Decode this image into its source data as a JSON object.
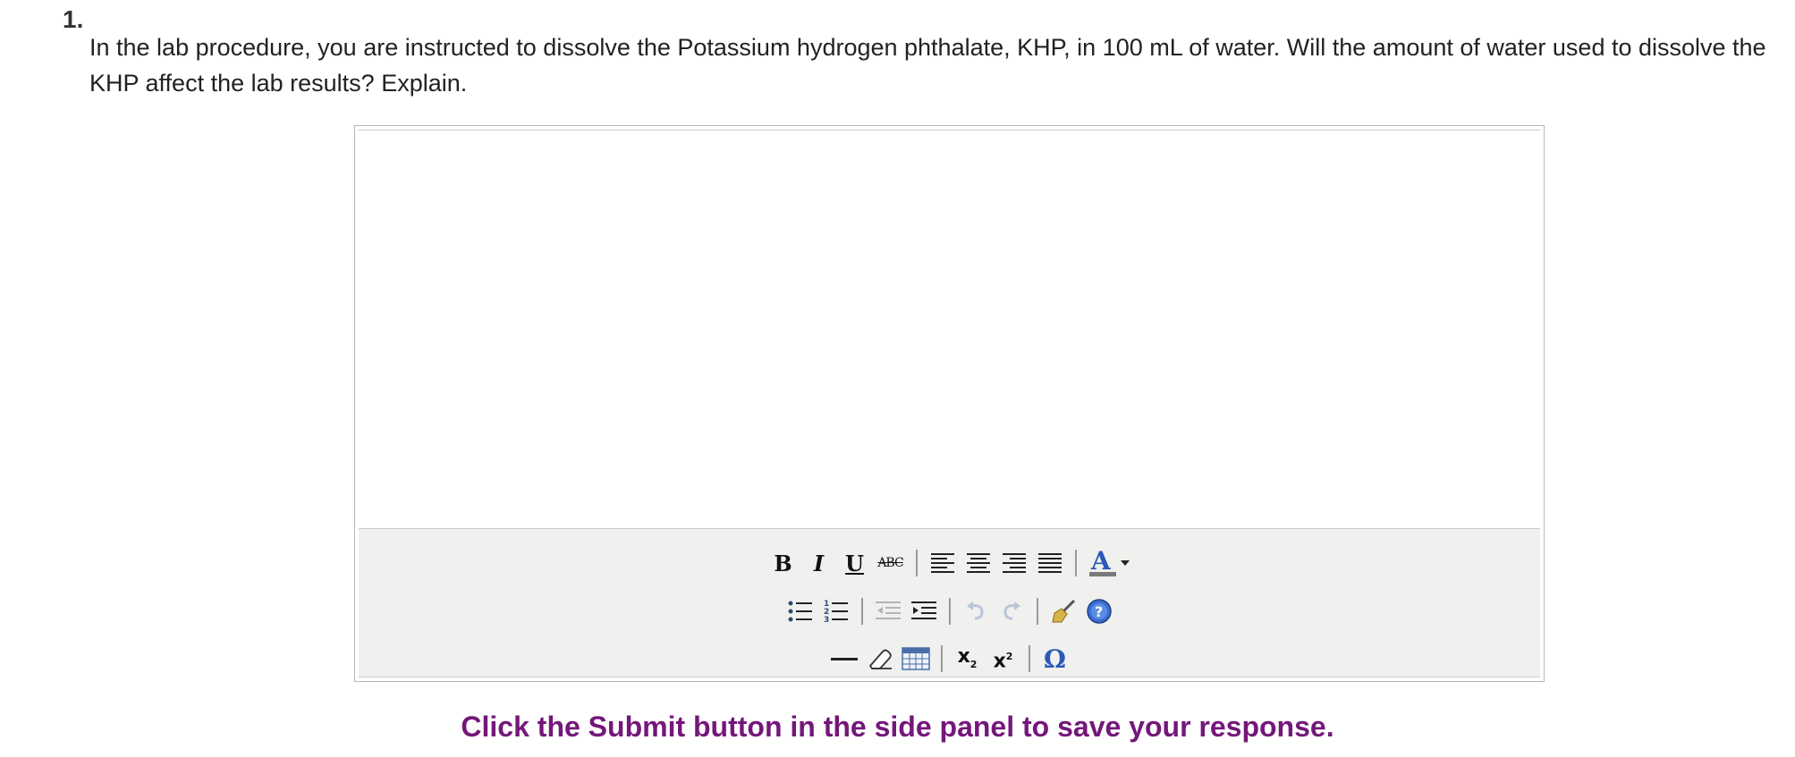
{
  "question": {
    "number": "1.",
    "text": "In the lab procedure, you are instructed to dissolve the Potassium hydrogen phthalate, KHP, in 100 mL of water. Will the amount of water used to dissolve the KHP affect the lab results? Explain."
  },
  "editor": {
    "value": "",
    "toolbar": {
      "bold_label": "B",
      "italic_label": "I",
      "underline_label": "U",
      "strikethrough_label": "ABC",
      "subscript_label": "x",
      "subscript_mark": "2",
      "superscript_label": "x",
      "superscript_mark": "2",
      "special_char_label": "Ω",
      "icons": [
        "bold-icon",
        "italic-icon",
        "underline-icon",
        "strikethrough-icon",
        "align-left-icon",
        "align-center-icon",
        "align-right-icon",
        "align-justify-icon",
        "font-color-icon",
        "dropdown-arrow-icon",
        "bullet-list-icon",
        "numbered-list-icon",
        "outdent-icon",
        "indent-icon",
        "undo-icon",
        "redo-icon",
        "cleanup-broom-icon",
        "help-icon",
        "horizontal-rule-icon",
        "eraser-icon",
        "table-icon",
        "subscript-icon",
        "superscript-icon",
        "special-character-icon"
      ]
    }
  },
  "hint": {
    "text": "Click the Submit button in the side panel to save your response."
  },
  "colors": {
    "hint": "#74177a",
    "toolbar_bg": "#f0f0ee",
    "help_blue": "#2a59b8",
    "font_color_blue": "#2a59b8"
  }
}
